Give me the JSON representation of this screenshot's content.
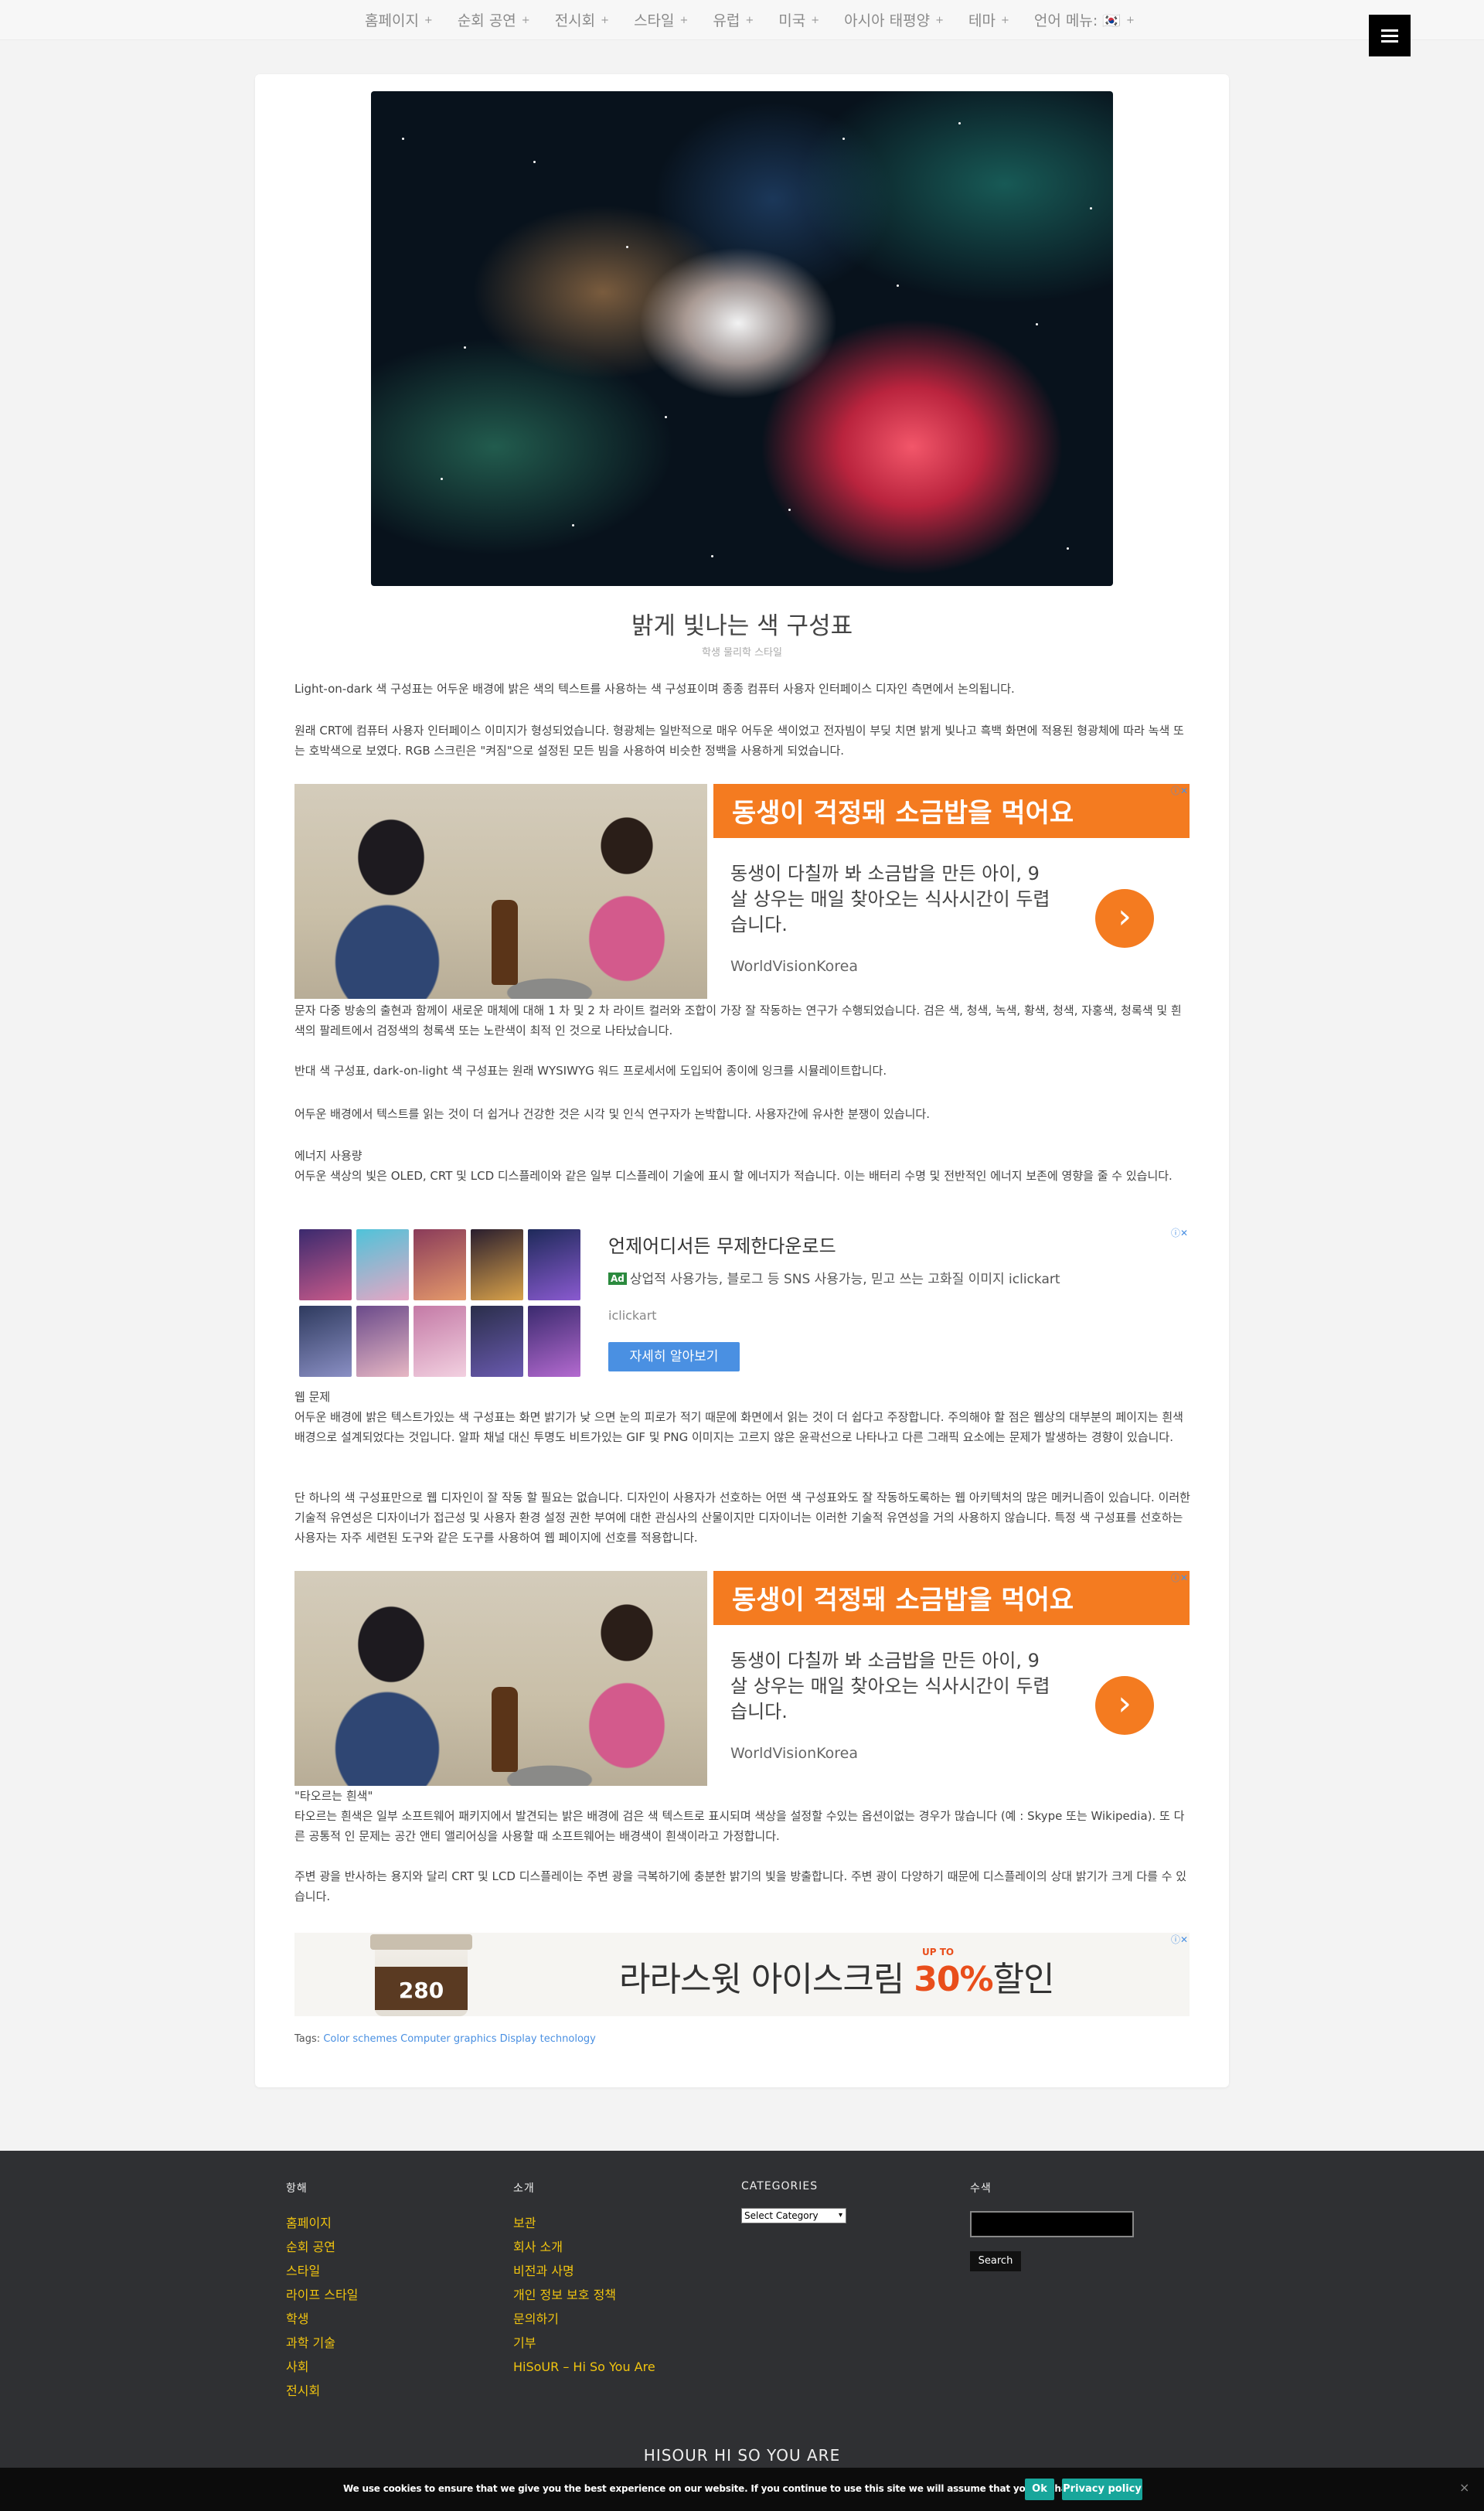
{
  "nav": {
    "items": [
      "홈페이지",
      "순회 공연",
      "전시회",
      "스타일",
      "유럽",
      "미국",
      "아시아 태평양",
      "테마",
      "언어 메뉴: 🇰🇷"
    ],
    "plus": "+"
  },
  "article": {
    "title": "밝게 빛나는 색 구성표",
    "subtitle": "학생 물리학 스타일",
    "p1": "Light-on-dark 색 구성표는 어두운 배경에 밝은 색의 텍스트를 사용하는 색 구성표이며 종종 컴퓨터 사용자 인터페이스 디자인 측면에서 논의됩니다.",
    "p2": "원래 CRT에 컴퓨터 사용자 인터페이스 이미지가 형성되었습니다. 형광체는 일반적으로 매우 어두운 색이었고 전자빔이 부딪 치면 밝게 빛나고 흑백 화면에 적용된 형광체에 따라 녹색 또는 호박색으로 보였다. RGB 스크린은 \"켜짐\"으로 설정된 모든 빔을 사용하여 비슷한 정백을 사용하게 되었습니다.",
    "p3": "문자 다중 방송의 출현과 함께이 새로운 매체에 대해 1 차 및 2 차 라이트 컬러와 조합이 가장 잘 작동하는 연구가 수행되었습니다. 검은 색, 청색, 녹색, 황색, 청색, 자홍색, 청록색 및 흰색의 팔레트에서 검정색의 청록색 또는 노란색이 최적 인 것으로 나타났습니다.",
    "p4": "반대 색 구성표, dark-on-light 색 구성표는 원래 WYSIWYG 워드 프로세서에 도입되어 종이에 잉크를 시뮬레이트합니다.",
    "p5": "어두운 배경에서 텍스트를 읽는 것이 더 쉽거나 건강한 것은 시각 및 인식 연구자가 논박합니다. 사용자간에 유사한 분쟁이 있습니다.",
    "h_energy": "에너지 사용량",
    "p6": "어두운 색상의 빛은 OLED, CRT 및 LCD 디스플레이와 같은 일부 디스플레이 기술에 표시 할 에너지가 적습니다. 이는 배터리 수명 및 전반적인 에너지 보존에 영향을 줄 수 있습니다.",
    "h_web": "웹 문제",
    "p7": "어두운 배경에 밝은 텍스트가있는 색 구성표는 화면 밝기가 낮 으면 눈의 피로가 적기 때문에 화면에서 읽는 것이 더 쉽다고 주장합니다. 주의해야 할 점은 웹상의 대부분의 페이지는 흰색 배경으로 설계되었다는 것입니다. 알파 채널 대신 투명도 비트가있는 GIF 및 PNG 이미지는 고르지 않은 윤곽선으로 나타나고 다른 그래픽 요소에는 문제가 발생하는 경향이 있습니다.",
    "p8": "단 하나의 색 구성표만으로 웹 디자인이 잘 작동 할 필요는 없습니다. 디자인이 사용자가 선호하는 어떤 색 구성표와도 잘 작동하도록하는 웹 아키텍처의 많은 메커니즘이 있습니다. 이러한 기술적 유연성은 디자이너가 접근성 및 사용자 환경 설정 권한 부여에 대한 관심사의 산물이지만 디자이너는 이러한 기술적 유연성을 거의 사용하지 않습니다. 특정 색 구성표를 선호하는 사용자는 자주 세련된 도구와 같은 도구를 사용하여 웹 페이지에 선호를 적용합니다.",
    "h_white": "\"타오르는 흰색\"",
    "p9": "타오르는 흰색은 일부 소프트웨어 패키지에서 발견되는 밝은 배경에 검은 색 텍스트로 표시되며 색상을 설정할 수있는 옵션이없는 경우가 많습니다 (예 : Skype 또는 Wikipedia). 또 다른 공통적 인 문제는 공간 앤티 앨리어싱을 사용할 때 소프트웨어는 배경색이 흰색이라고 가정합니다.",
    "p10": "주변 광을 반사하는 용지와 달리 CRT 및 LCD 디스플레이는 주변 광을 극복하기에 충분한 밝기의 빛을 방출합니다. 주변 광이 다양하기 때문에 디스플레이의 상대 밝기가 크게 다를 수 있습니다.",
    "tags_label": "Tags:",
    "tags": [
      "Color schemes",
      "Computer graphics",
      "Display technology"
    ]
  },
  "ads": {
    "worldvision": {
      "headline": "동생이 걱정돼 소금밥을 먹어요",
      "body": "동생이 다칠까 봐 소금밥을 만든 아이, 9살 상우는 매일 찾아오는 식사시간이 두렵습니다.",
      "brand": "WorldVisionKorea",
      "go": "›",
      "adchoice": "ⓘ✕"
    },
    "iclickart": {
      "headline": "언제어디서든 무제한다운로드",
      "ad_badge": "Ad",
      "desc": "상업적 사용가능, 블로그 등 SNS 사용가능, 믿고 쓰는 고화질 이미지 iclickart",
      "source": "iclickart",
      "button": "자세히 알아보기",
      "adchoice": "ⓘ✕"
    },
    "icecream": {
      "text_main": "라라스윗 아이스크림 ",
      "text_pct": "30%",
      "text_tail": "할인",
      "upto": "UP TO",
      "cup_number": "280",
      "adchoice": "ⓘ✕"
    }
  },
  "footer": {
    "col1": {
      "title": "항해",
      "items": [
        "홈페이지",
        "순회 공연",
        "스타일",
        "라이프 스타일",
        "학생",
        "과학 기술",
        "사회",
        "전시회"
      ]
    },
    "col2": {
      "title": "소개",
      "items": [
        "보관",
        "회사 소개",
        "비전과 사명",
        "개인 정보 보호 정책",
        "문의하기",
        "기부",
        "HiSoUR – Hi So You Are"
      ]
    },
    "col3": {
      "title": "CATEGORIES",
      "select": "Select Category"
    },
    "col4": {
      "title": "수색",
      "button": "Search"
    },
    "brand": "HISOUR HI SO YOU ARE"
  },
  "cookie": {
    "message": "We use cookies to ensure that we give you the best experience on our website. If you continue to use this site we will assume that you are happy with it.",
    "ok": "Ok",
    "policy": "Privacy policy",
    "close": "×"
  },
  "colors": {
    "accent_orange": "#f47b20",
    "link_blue": "#4a90e2",
    "footer_link": "#f1c40f",
    "footer_bg": "#2f3033",
    "cookie_button": "#18a69b"
  }
}
